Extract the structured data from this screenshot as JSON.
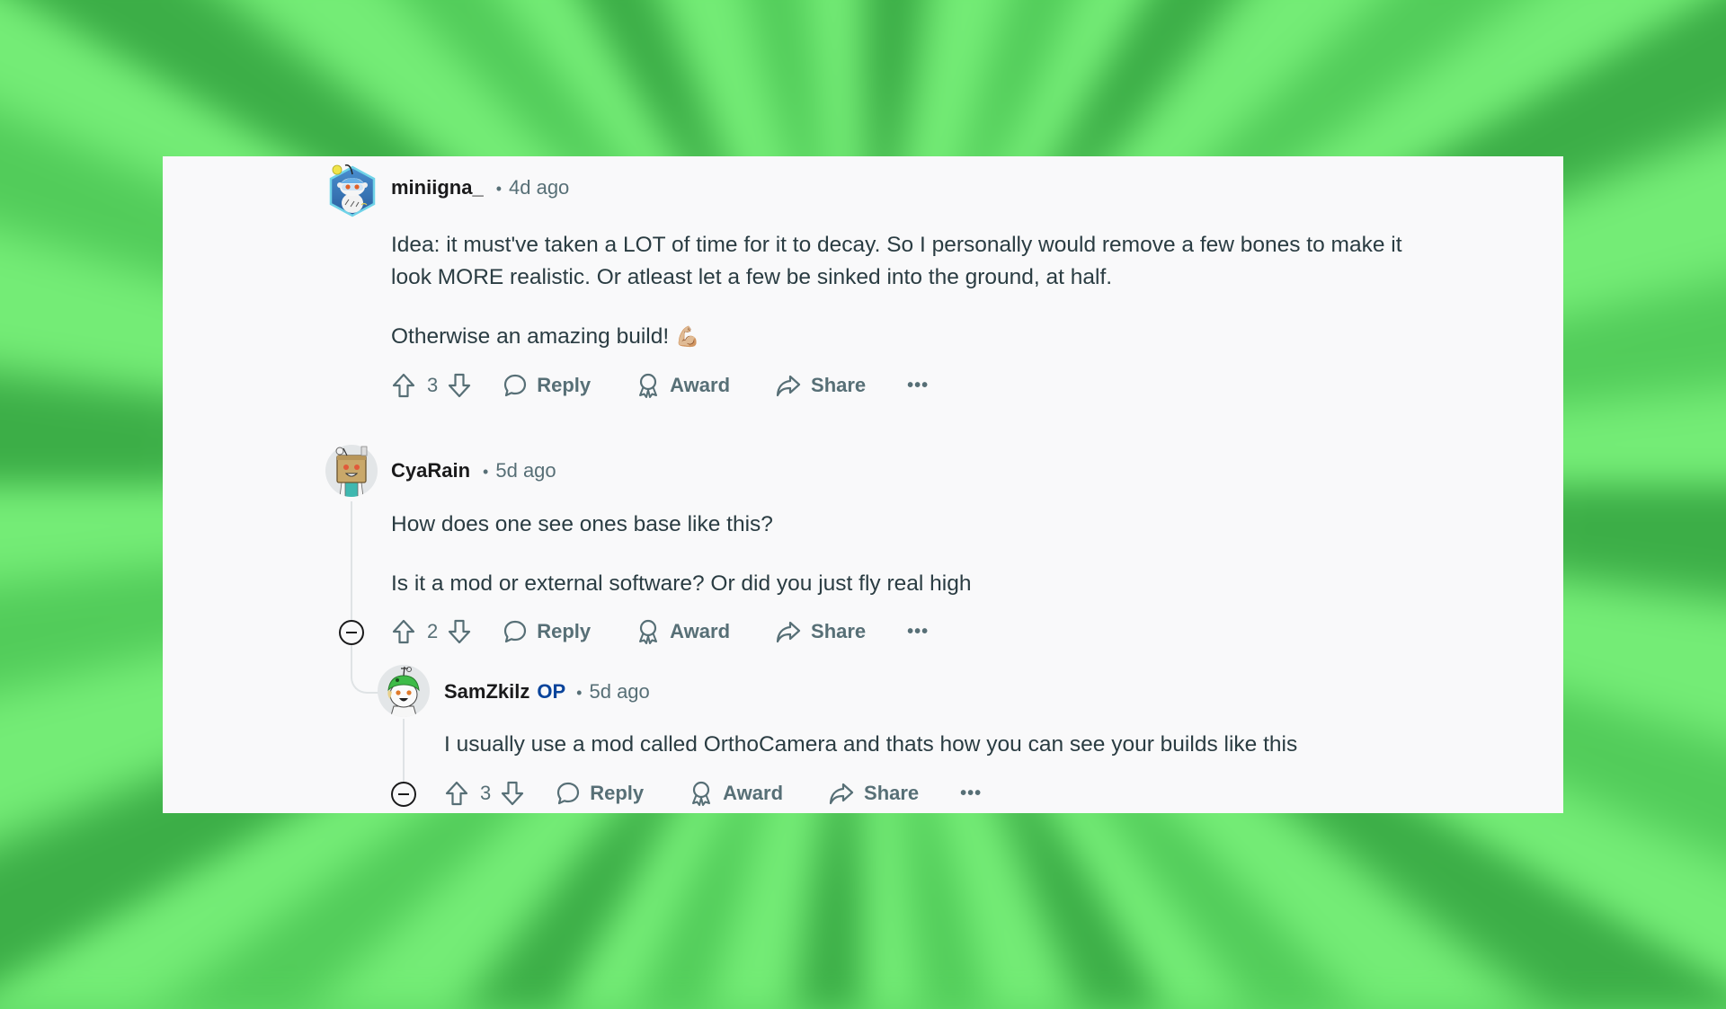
{
  "colors": {
    "card_bg": "#f9f9fa",
    "text_primary": "#1a1a1b",
    "text_body": "#2a3c42",
    "text_muted": "#576f76",
    "op_badge": "#0a449b",
    "thread_line": "#dfe3e5",
    "bg_green_light": "#74ec76",
    "bg_green_dark": "#3cae47"
  },
  "actions": {
    "reply_label": "Reply",
    "award_label": "Award",
    "share_label": "Share",
    "more_label": "•••"
  },
  "separator": "•",
  "comments": [
    {
      "username": "miniigna_",
      "is_op": false,
      "time": "4d ago",
      "avatar_icon": "snoo-avatar-hexagon-icon",
      "paragraphs": [
        [
          "Idea: it must've taken a LOT of time for it to decay. So I personally would remove a few bones to make it",
          "look MORE realistic. Or atleast let a few be sinked into the ground, at half."
        ],
        [
          "Otherwise an amazing build!"
        ]
      ],
      "emoji": "💪🏼",
      "votes": "3"
    },
    {
      "username": "CyaRain",
      "is_op": false,
      "time": "5d ago",
      "avatar_icon": "snoo-avatar-box-head-icon",
      "paragraphs": [
        [
          "How does one see ones base like this?"
        ],
        [
          "Is it a mod or external software? Or did you just fly real high"
        ]
      ],
      "votes": "2"
    },
    {
      "username": "SamZkilz",
      "is_op": true,
      "op_label": "OP",
      "time": "5d ago",
      "avatar_icon": "snoo-avatar-frog-hat-icon",
      "paragraphs": [
        [
          "I usually use a mod called OrthoCamera and thats how you can see your builds like this"
        ]
      ],
      "votes": "3"
    }
  ]
}
